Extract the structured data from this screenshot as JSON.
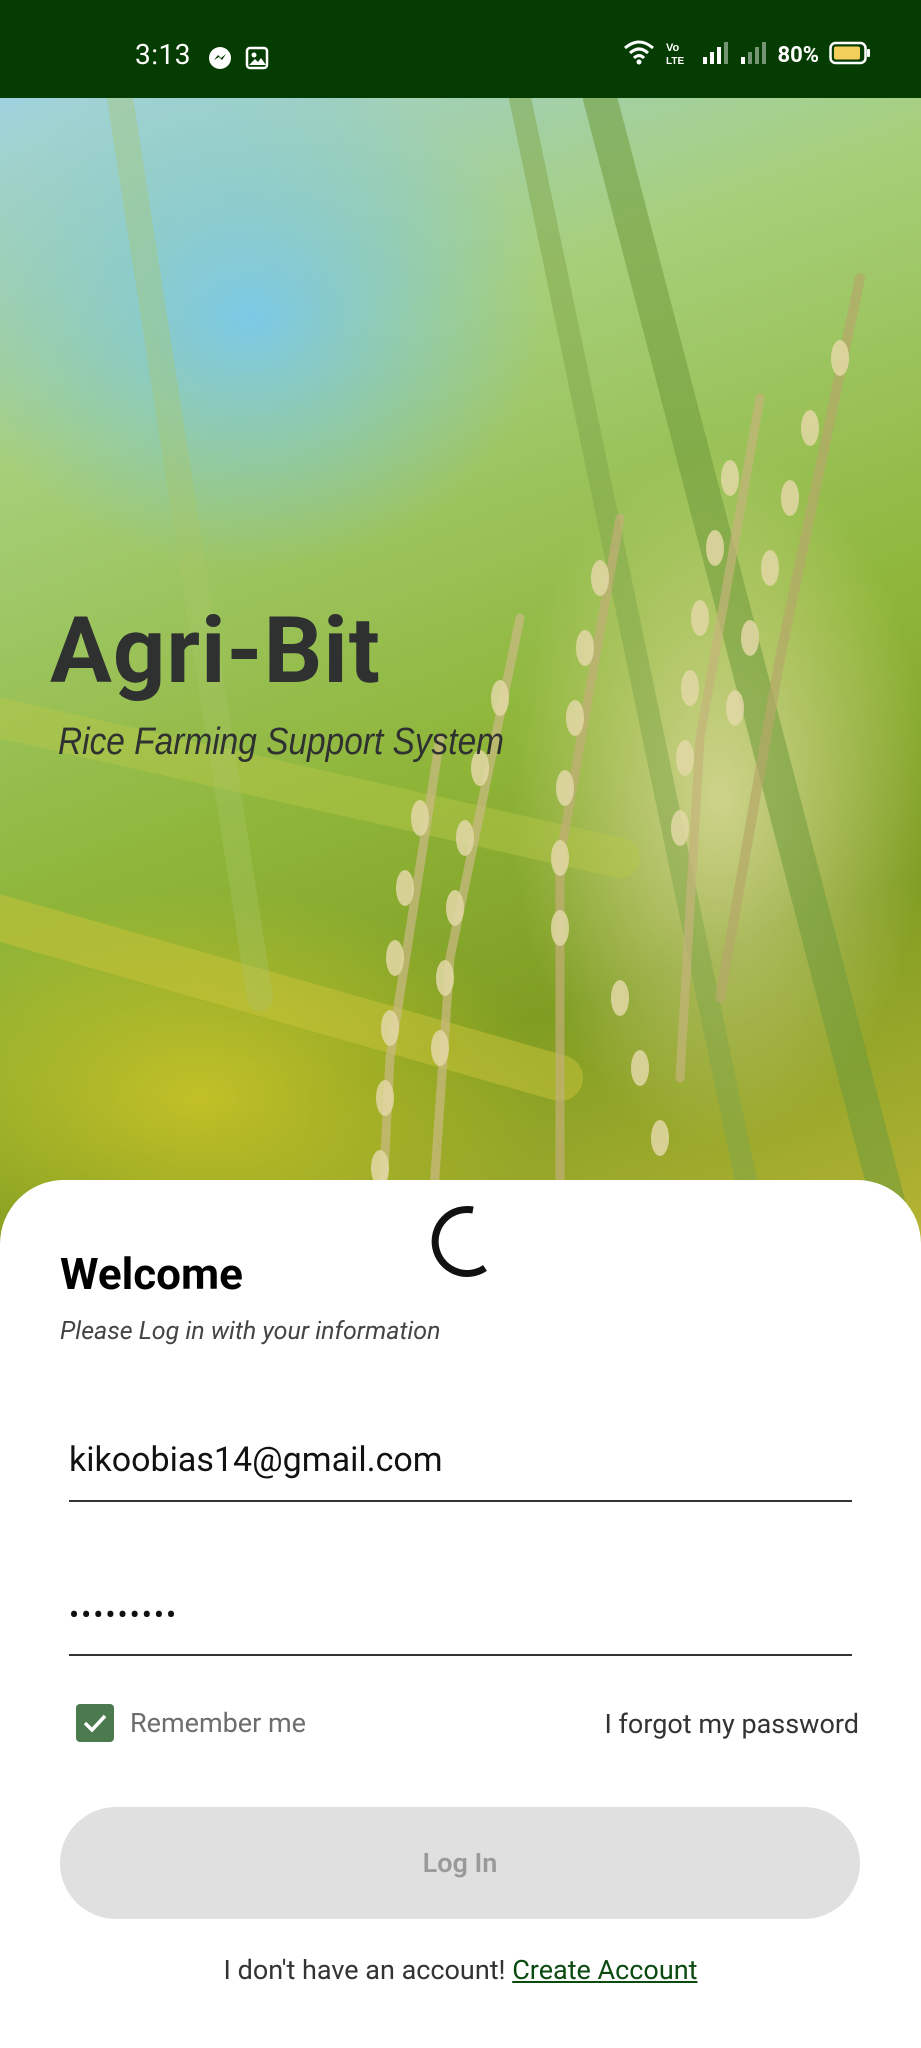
{
  "status_bar": {
    "time": "3:13",
    "battery": "80%",
    "icons": [
      "messenger-icon",
      "photo-icon",
      "wifi-icon",
      "volte-icon",
      "signal-icon",
      "signal-icon",
      "battery-icon"
    ]
  },
  "brand": {
    "title": "Agri-Bit",
    "subtitle": "Rice Farming Support System"
  },
  "login": {
    "welcome": "Welcome",
    "instructions": "Please Log in with your information",
    "email_value": "kikoobias14@gmail.com",
    "password_value": "•••••••••",
    "remember_me_label": "Remember me",
    "remember_me_checked": true,
    "forgot_password": "I forgot my password",
    "login_button": "Log In",
    "no_account_text": "I don't have an account!",
    "create_account": "Create Account"
  },
  "colors": {
    "status_bar_bg": "#053c02",
    "checkbox": "#4b7a4f",
    "link": "#0b4a10",
    "button_disabled_bg": "#e0e0e0"
  }
}
